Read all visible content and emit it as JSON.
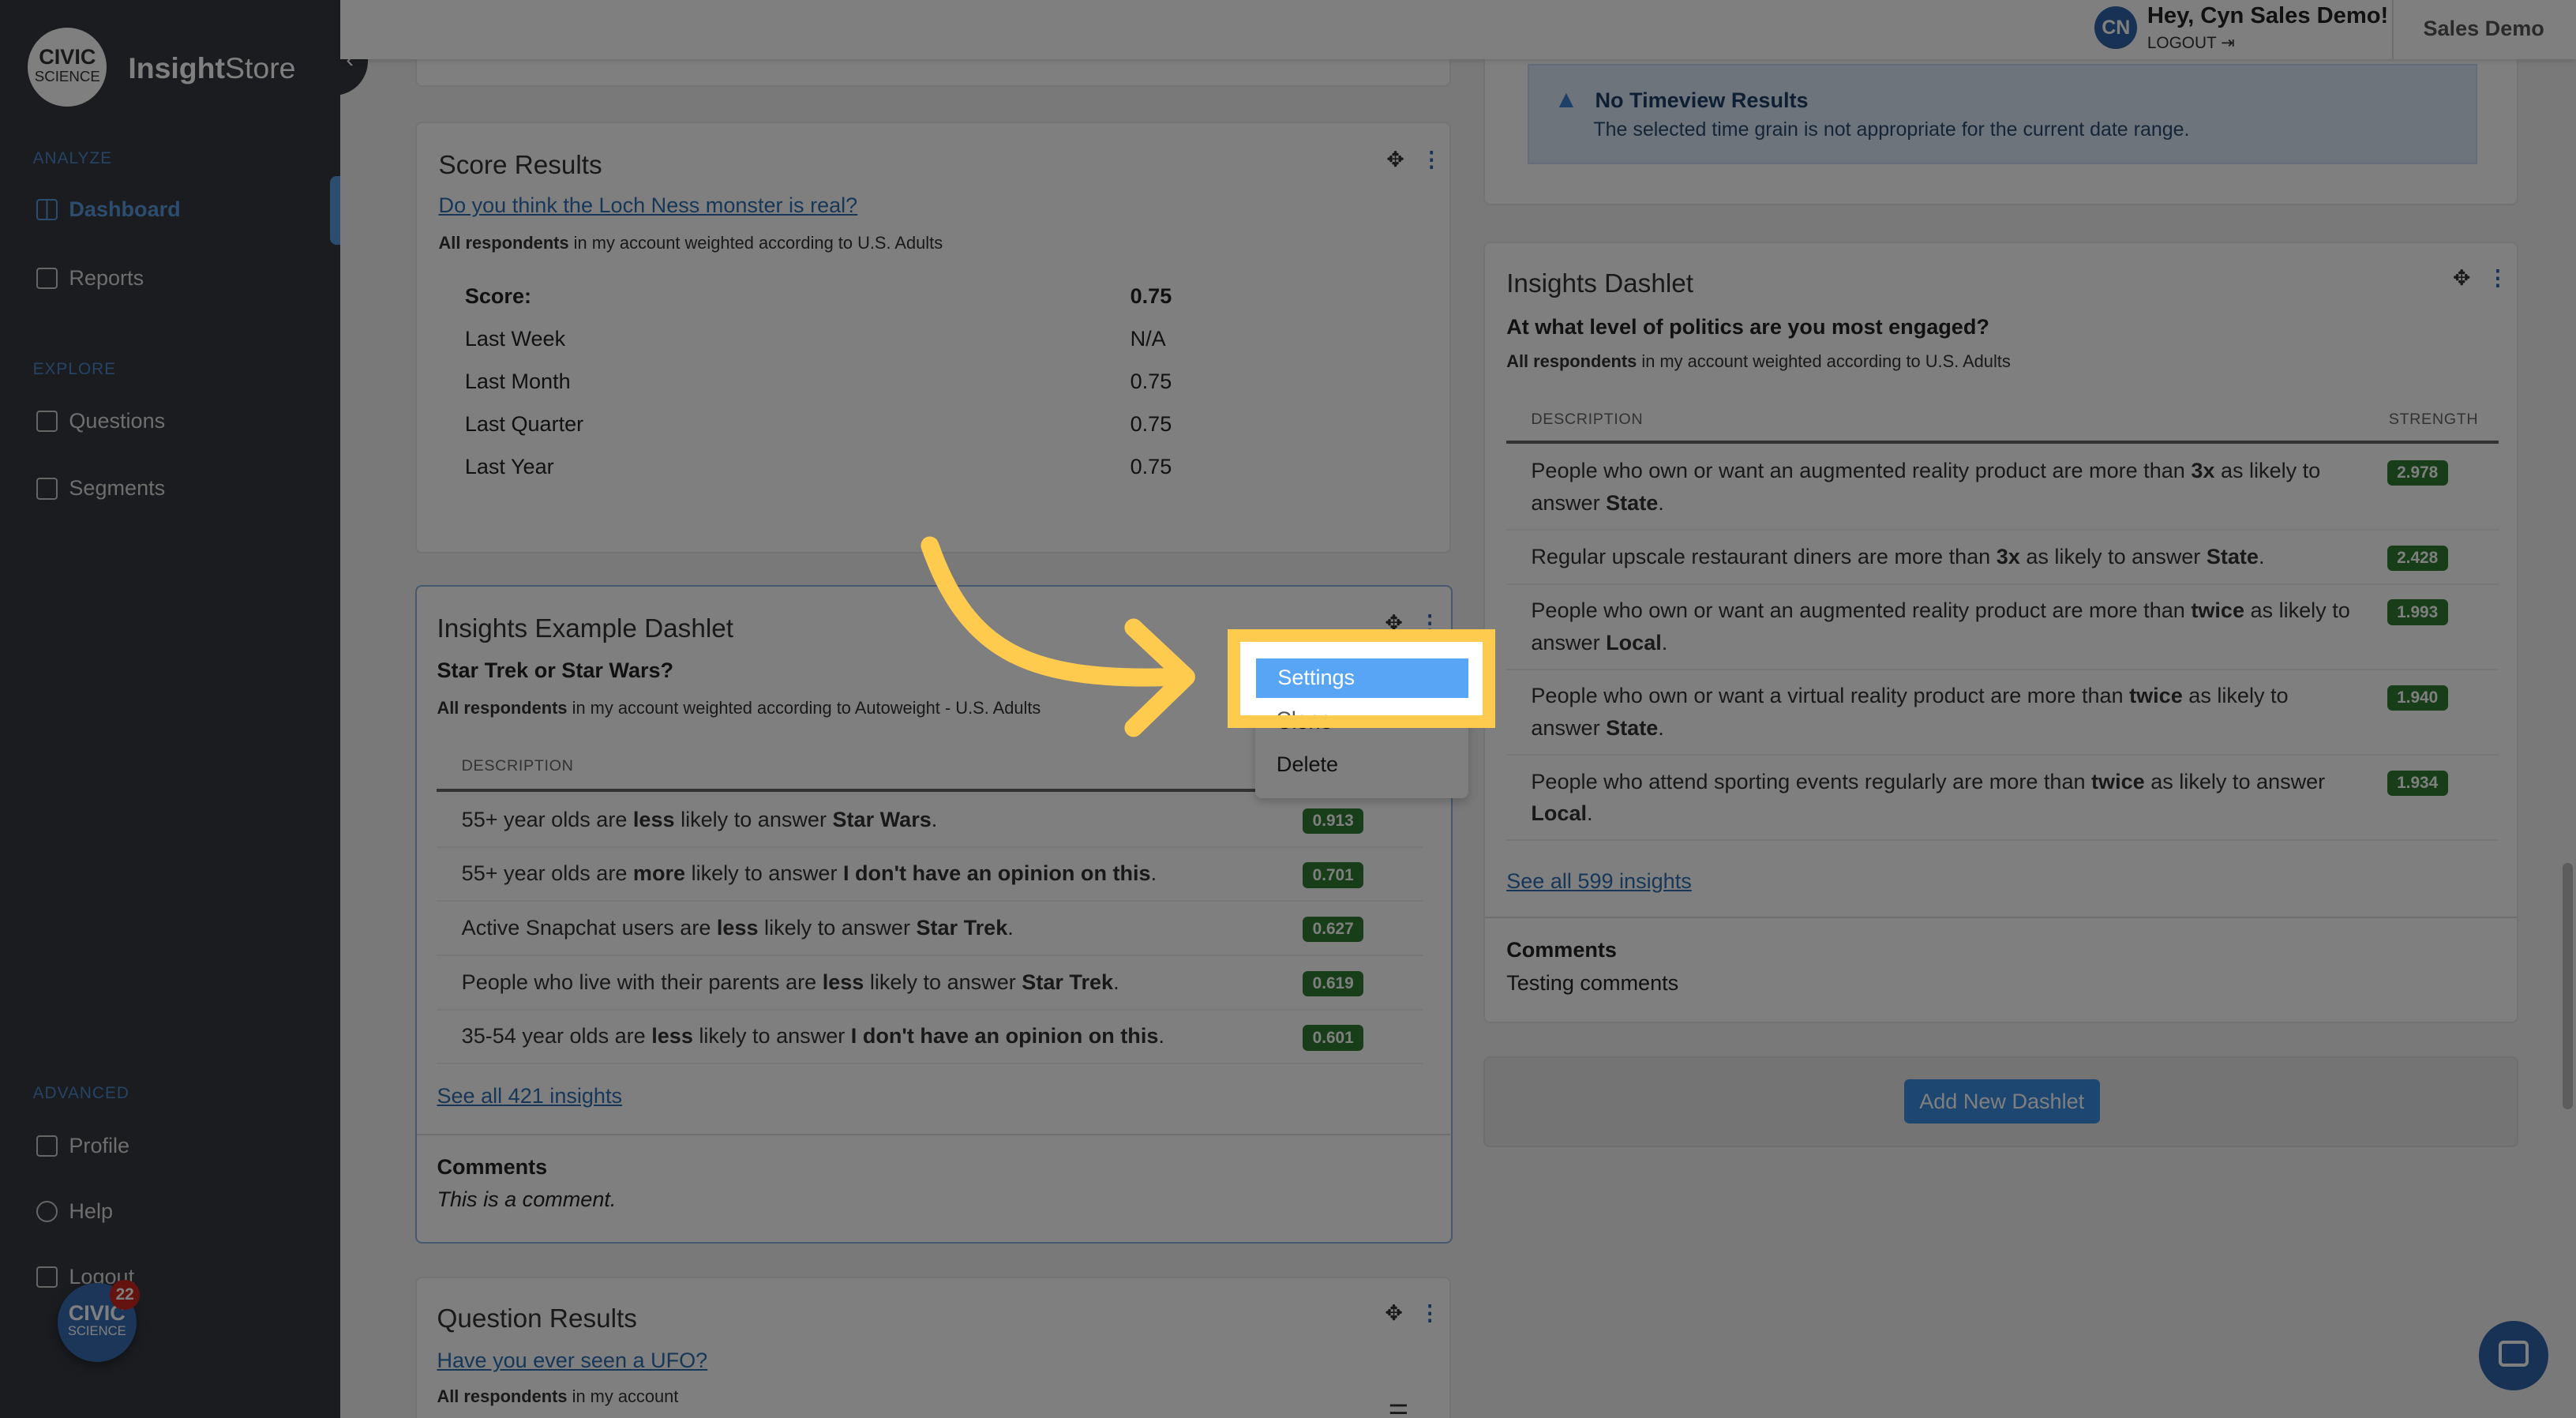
{
  "brand": {
    "logo_line1": "CIVIC",
    "logo_line2": "SCIENCE",
    "name_bold": "Insight",
    "name_rest": "Store",
    "collapse_icon": "chevron-left"
  },
  "sidebar": {
    "sections": [
      {
        "label": "ANALYZE"
      },
      {
        "label": "EXPLORE"
      },
      {
        "label": "ADVANCED"
      }
    ],
    "items": [
      {
        "label": "Dashboard",
        "icon": "dashboard-icon",
        "active": true
      },
      {
        "label": "Reports",
        "icon": "report-icon"
      },
      {
        "label": "Questions",
        "icon": "question-icon"
      },
      {
        "label": "Segments",
        "icon": "segments-icon"
      },
      {
        "label": "Profile",
        "icon": "id-card-icon"
      },
      {
        "label": "Help",
        "icon": "lifebuoy-icon"
      },
      {
        "label": "Logout",
        "icon": "logout-icon"
      }
    ],
    "bubble": {
      "line1": "CIVIC",
      "line2": "SCIENCE",
      "count": "22"
    }
  },
  "header": {
    "avatar": "CN",
    "greeting": "Hey, Cyn Sales Demo!",
    "logout": "LOGOUT",
    "account": "Sales Demo"
  },
  "colors": {
    "accent": "#5a9be0",
    "badge": "#2f7d32",
    "highlight": "#fecb4e",
    "menu_active": "#58a5f5"
  },
  "score_card": {
    "title": "Score Results",
    "question": "Do you think the Loch Ness monster is real?",
    "resp_bold": "All respondents",
    "resp_rest": " in my account weighted according to U.S. Adults",
    "rows": [
      {
        "label": "Score:",
        "value": "0.75",
        "bold": true
      },
      {
        "label": "Last Week",
        "value": "N/A"
      },
      {
        "label": "Last Month",
        "value": "0.75"
      },
      {
        "label": "Last Quarter",
        "value": "0.75"
      },
      {
        "label": "Last Year",
        "value": "0.75"
      }
    ]
  },
  "example_card": {
    "title": "Insights Example Dashlet",
    "question": "Star Trek or Star Wars?",
    "resp_bold": "All respondents",
    "resp_rest": " in my account weighted according to Autoweight - U.S. Adults",
    "col_desc": "DESCRIPTION",
    "rows": [
      {
        "parts": [
          {
            "t": "55+ year olds are "
          },
          {
            "t": "less",
            "b": true
          },
          {
            "t": " likely to answer "
          },
          {
            "t": "Star Wars",
            "b": true
          },
          {
            "t": "."
          }
        ],
        "value": "0.913"
      },
      {
        "parts": [
          {
            "t": "55+ year olds are "
          },
          {
            "t": "more",
            "b": true
          },
          {
            "t": " likely to answer "
          },
          {
            "t": "I don't have an opinion on this",
            "b": true
          },
          {
            "t": "."
          }
        ],
        "value": "0.701"
      },
      {
        "parts": [
          {
            "t": "Active Snapchat users are "
          },
          {
            "t": "less",
            "b": true
          },
          {
            "t": " likely to answer "
          },
          {
            "t": "Star Trek",
            "b": true
          },
          {
            "t": "."
          }
        ],
        "value": "0.627"
      },
      {
        "parts": [
          {
            "t": "People who live with their parents are "
          },
          {
            "t": "less",
            "b": true
          },
          {
            "t": " likely to answer "
          },
          {
            "t": "Star Trek",
            "b": true
          },
          {
            "t": "."
          }
        ],
        "value": "0.619"
      },
      {
        "parts": [
          {
            "t": "35-54 year olds are "
          },
          {
            "t": "less",
            "b": true
          },
          {
            "t": " likely to answer "
          },
          {
            "t": "I don't have an opinion on this",
            "b": true
          },
          {
            "t": "."
          }
        ],
        "value": "0.601"
      }
    ],
    "see_all": "See all 421 insights",
    "comments_label": "Comments",
    "comment": "This is a comment."
  },
  "context_menu": {
    "items": [
      "Settings",
      "Clone",
      "Delete"
    ]
  },
  "question_card": {
    "title": "Question Results",
    "question": "Have you ever seen a UFO?",
    "resp_bold": "All respondents",
    "resp_rest": " in my account"
  },
  "timeview_card": {
    "alert_title": "No Timeview Results",
    "alert_text": "The selected time grain is not appropriate for the current date range."
  },
  "insights_card": {
    "title": "Insights Dashlet",
    "question": "At what level of politics are you most engaged?",
    "resp_bold": "All respondents",
    "resp_rest": " in my account weighted according to U.S. Adults",
    "col_desc": "DESCRIPTION",
    "col_strength": "STRENGTH",
    "rows": [
      {
        "parts": [
          {
            "t": "People who own or want an augmented reality product are more than "
          },
          {
            "t": "3x",
            "b": true
          },
          {
            "t": " as likely to answer "
          },
          {
            "t": "State",
            "b": true
          },
          {
            "t": "."
          }
        ],
        "value": "2.978"
      },
      {
        "parts": [
          {
            "t": "Regular upscale restaurant diners are more than "
          },
          {
            "t": "3x",
            "b": true
          },
          {
            "t": " as likely to answer "
          },
          {
            "t": "State",
            "b": true
          },
          {
            "t": "."
          }
        ],
        "value": "2.428"
      },
      {
        "parts": [
          {
            "t": "People who own or want an augmented reality product are more than "
          },
          {
            "t": "twice",
            "b": true
          },
          {
            "t": " as likely to answer "
          },
          {
            "t": "Local",
            "b": true
          },
          {
            "t": "."
          }
        ],
        "value": "1.993"
      },
      {
        "parts": [
          {
            "t": "People who own or want a virtual reality product are more than "
          },
          {
            "t": "twice",
            "b": true
          },
          {
            "t": " as likely to answer "
          },
          {
            "t": "State",
            "b": true
          },
          {
            "t": "."
          }
        ],
        "value": "1.940"
      },
      {
        "parts": [
          {
            "t": "People who attend sporting events regularly are more than "
          },
          {
            "t": "twice",
            "b": true
          },
          {
            "t": " as likely to answer "
          },
          {
            "t": "Local",
            "b": true
          },
          {
            "t": "."
          }
        ],
        "value": "1.934"
      }
    ],
    "see_all": "See all 599 insights",
    "comments_label": "Comments",
    "comment": "Testing comments"
  },
  "add_dashlet": "Add New Dashlet"
}
